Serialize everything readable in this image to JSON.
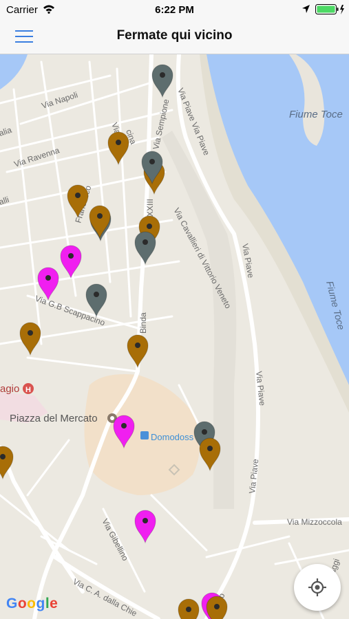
{
  "status_bar": {
    "carrier": "Carrier",
    "time": "6:22 PM"
  },
  "nav": {
    "title": "Fermate qui vicino",
    "menu_icon": "hamburger-menu-icon"
  },
  "map": {
    "streets": {
      "via_napoli": "Via Napoli",
      "via_ravenna": "Via Ravenna",
      "via_sempione": "Via Sempione",
      "via_piave_1": "Via Piave Via Piave",
      "via_cavallieri": "Via Cavallieri di Vittorio Veneto",
      "via_piave_2": "Via Piave",
      "via_piave_3": "Via Piave",
      "via_piave_4": "Via Piave",
      "via_scappacino": "Via G.B Scappacino",
      "via_binda": "Binda",
      "via_xxiii": "XXIII",
      "via_gibellino": "Via Gibellino",
      "via_dalla_chiesa": "Via C. A. dalla Chie",
      "via_mizzoccola": "Via Mizzoccola",
      "via_maggi": "Maggi",
      "via_cina": "cina",
      "via_francesco": "Francesco",
      "via_c": "Via C",
      "alia_1": "alia",
      "alia_2": "alli",
      "mo": "mo"
    },
    "places": {
      "fiume_toce_1": "Fiume Toce",
      "fiume_toce_2": "Fiume Toce",
      "piazza_mercato": "Piazza del Mercato",
      "domodossola": "Domodoss",
      "ospedale_fragment": "agio"
    },
    "pin_colors": {
      "brown": "#a86e07",
      "grey": "#5d6d6e",
      "magenta": "#f01ff0"
    },
    "pins": [
      {
        "kind": "grey"
      },
      {
        "kind": "brown"
      },
      {
        "kind": "brown"
      },
      {
        "kind": "grey"
      },
      {
        "kind": "brown"
      },
      {
        "kind": "brown"
      },
      {
        "kind": "grey"
      },
      {
        "kind": "grey"
      },
      {
        "kind": "magenta"
      },
      {
        "kind": "magenta"
      },
      {
        "kind": "grey"
      },
      {
        "kind": "brown"
      },
      {
        "kind": "brown"
      },
      {
        "kind": "magenta"
      },
      {
        "kind": "grey"
      },
      {
        "kind": "brown"
      },
      {
        "kind": "brown"
      },
      {
        "kind": "magenta"
      },
      {
        "kind": "brown"
      },
      {
        "kind": "magenta"
      },
      {
        "kind": "brown"
      },
      {
        "kind": "brown"
      }
    ]
  },
  "controls": {
    "locate_icon": "crosshair-locate-icon"
  },
  "attribution": {
    "google": "Google"
  }
}
